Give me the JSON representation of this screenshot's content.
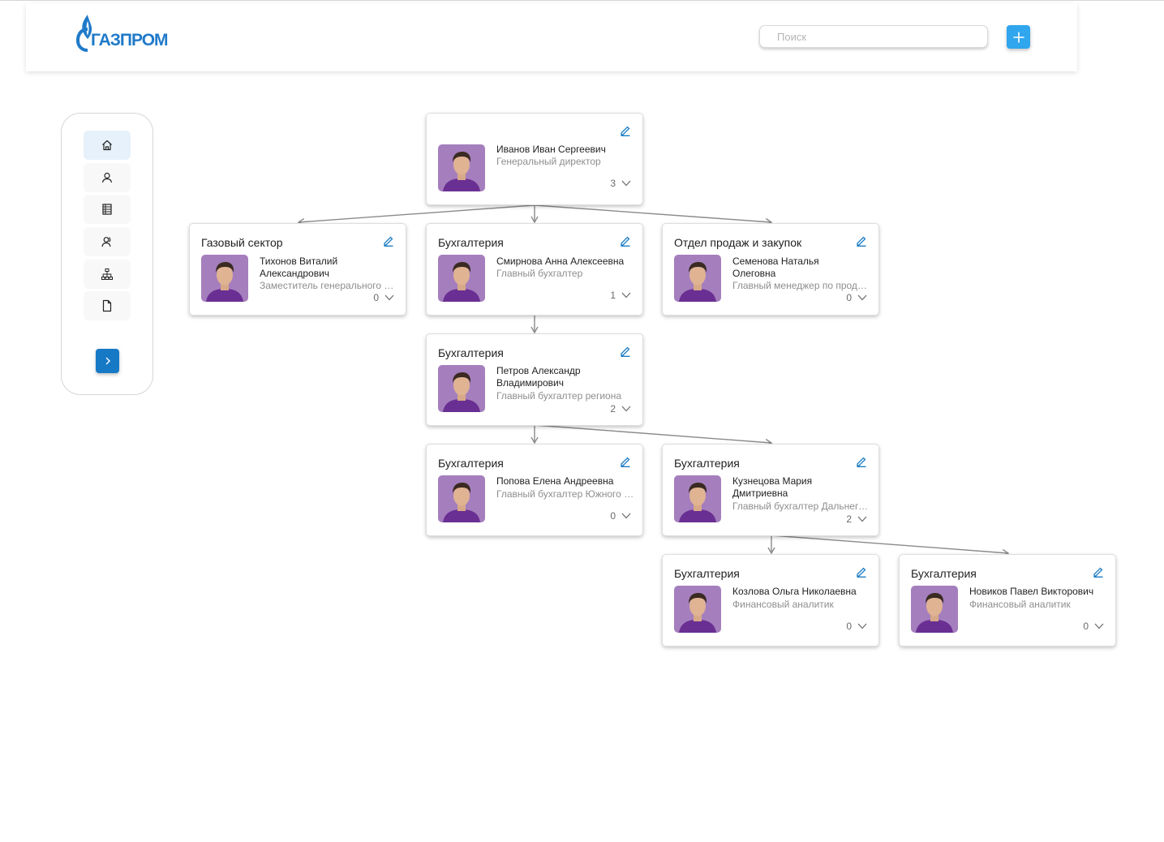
{
  "header": {
    "logo_text": "ГАЗПРОМ",
    "search_placeholder": "Поиск"
  },
  "sidebar": {
    "items": [
      {
        "icon": "home-icon",
        "active": true
      },
      {
        "icon": "user-icon"
      },
      {
        "icon": "ledger-icon"
      },
      {
        "icon": "users-icon"
      },
      {
        "icon": "org-chart-icon"
      },
      {
        "icon": "document-icon"
      }
    ]
  },
  "colors": {
    "accent": "#2fa6ee",
    "accent_dark": "#1679c6",
    "edit_icon": "#1b7cc4",
    "photo_bg": "#7a4a9c",
    "connector": "#8a8a8a"
  },
  "cards": [
    {
      "department": "",
      "name": "Иванов Иван Сергеевич",
      "role": "Генеральный директор",
      "count": "3"
    },
    {
      "department": "Газовый сектор",
      "name": "Тихонов Виталий Александрович",
      "role": "Заместитель генерального директора",
      "count": "0"
    },
    {
      "department": "Бухгалтерия",
      "name": "Смирнова Анна Алексеевна",
      "role": "Главный бухгалтер",
      "count": "1"
    },
    {
      "department": "Отдел продаж и закупок",
      "name": "Семенова Наталья Олеговна",
      "role": "Главный менеджер по продажам",
      "count": "0"
    },
    {
      "department": "Бухгалтерия",
      "name": "Петров Александр Владимирович",
      "role": "Главный бухгалтер региона",
      "count": "2"
    },
    {
      "department": "Бухгалтерия",
      "name": "Попова Елена Андреевна",
      "role": "Главный бухгалтер Южного региона",
      "count": "0"
    },
    {
      "department": "Бухгалтерия",
      "name": "Кузнецова Мария Дмитриевна",
      "role": "Главный бухгалтер Дальнего Востока",
      "count": "2"
    },
    {
      "department": "Бухгалтерия",
      "name": "Козлова Ольга Николаевна",
      "role": "Финансовый аналитик",
      "count": "0"
    },
    {
      "department": "Бухгалтерия",
      "name": "Новиков Павел Викторович",
      "role": "Финансовый аналитик",
      "count": "0"
    }
  ]
}
